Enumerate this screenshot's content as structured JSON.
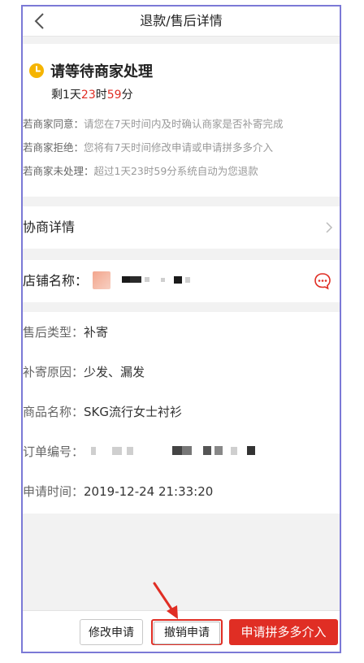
{
  "header": {
    "title": "退款/售后详情"
  },
  "status": {
    "title": "请等待商家处理",
    "countdown": {
      "prefix": "剩",
      "days": "1",
      "days_unit": "天",
      "hours": "23",
      "hours_unit": "时",
      "minutes": "59",
      "minutes_unit": "分"
    }
  },
  "rules": [
    {
      "label": "若商家同意：",
      "text": "请您在7天时间内及时确认商家是否补寄完成"
    },
    {
      "label": "若商家拒绝：",
      "text": "您将有7天时间修改申请或申请拼多多介入"
    },
    {
      "label": "若商家未处理：",
      "text": "超过1天23时59分系统自动为您退款"
    }
  ],
  "negotiation": {
    "label": "协商详情"
  },
  "store": {
    "label": "店铺名称："
  },
  "details": {
    "type": {
      "label": "售后类型：",
      "value": "补寄"
    },
    "reason": {
      "label": "补寄原因：",
      "value": "少发、漏发"
    },
    "product": {
      "label": "商品名称：",
      "value": "SKG流行女士衬衫"
    },
    "order": {
      "label": "订单编号："
    },
    "time": {
      "label": "申请时间：",
      "value": "2019-12-24 21:33:20"
    }
  },
  "actions": {
    "modify": "修改申请",
    "cancel": "撤销申请",
    "appeal": "申请拼多多介入"
  },
  "colors": {
    "accent": "#e02e24",
    "clock": "#f5b400",
    "highlight_box": "#e02e24",
    "frame": "#7b79d6"
  }
}
